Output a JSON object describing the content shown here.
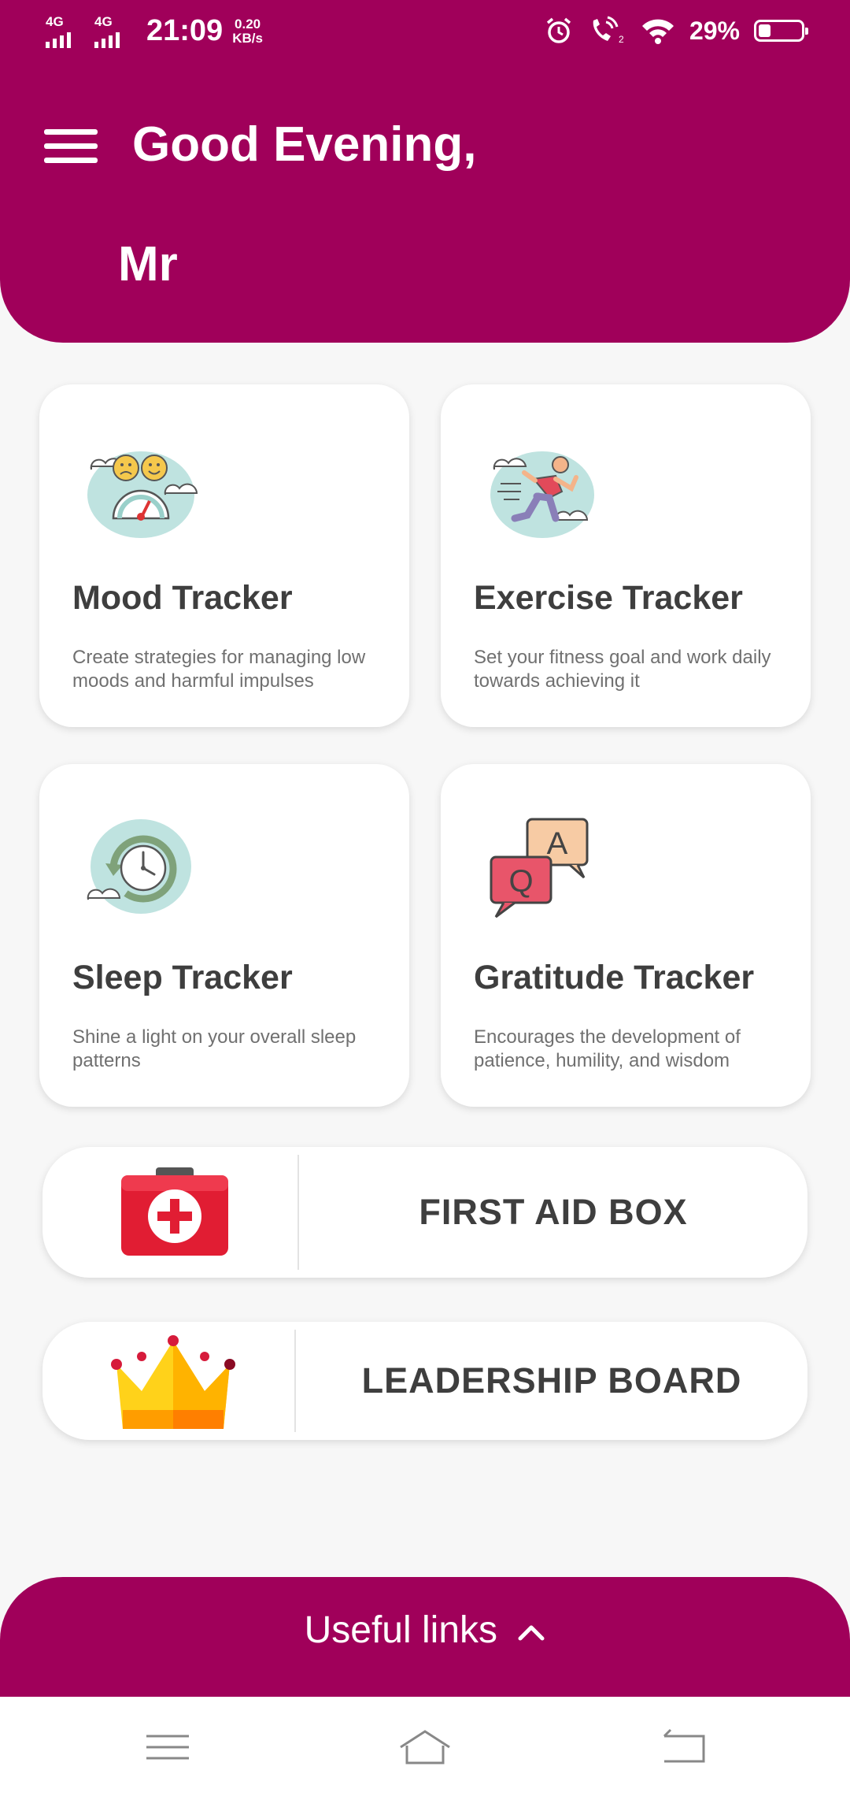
{
  "status_bar": {
    "network1": "4G",
    "network2": "4G",
    "time": "21:09",
    "speed_value": "0.20",
    "speed_unit": "KB/s",
    "battery_percent": "29%",
    "battery_level": 0.29
  },
  "header": {
    "greeting": "Good Evening,",
    "user_name": "Mr"
  },
  "cards": [
    {
      "title": "Mood Tracker",
      "description": "Create strategies for managing low moods and harmful impulses",
      "icon": "mood-meter-icon"
    },
    {
      "title": "Exercise Tracker",
      "description": "Set your fitness goal and work daily towards achieving it",
      "icon": "runner-icon"
    },
    {
      "title": "Sleep Tracker",
      "description": "Shine a light on your overall sleep patterns",
      "icon": "clock-icon"
    },
    {
      "title": "Gratitude Tracker",
      "description": "Encourages the development of patience, humility, and wisdom",
      "icon": "qa-chat-icon"
    }
  ],
  "first_aid": {
    "label": "FIRST AID BOX",
    "icon": "first-aid-kit-icon"
  },
  "leadership": {
    "label": "LEADERSHIP BOARD",
    "icon": "crown-icon"
  },
  "useful_links": {
    "label": "Useful links",
    "icon": "chevron-up-icon"
  },
  "colors": {
    "primary": "#a0005a",
    "card_title": "#3e3e3e",
    "card_text": "#707070",
    "background": "#f7f7f7"
  }
}
